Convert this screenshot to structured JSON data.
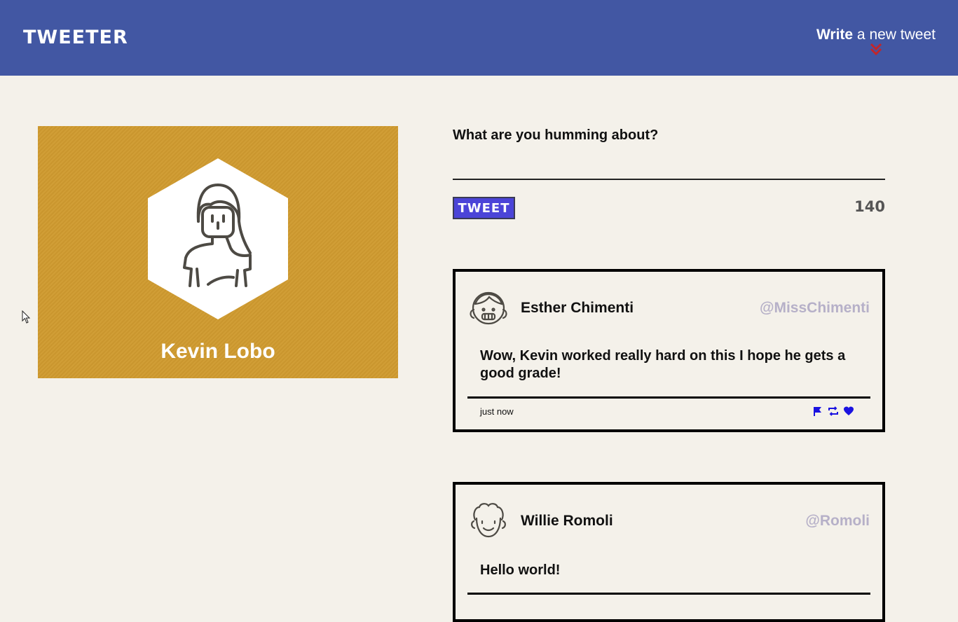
{
  "nav": {
    "brand": "TWEETER",
    "compose_bold": "Write",
    "compose_rest": " a new tweet"
  },
  "profile": {
    "name": "Kevin Lobo",
    "avatar_icon": "girl-avatar-icon"
  },
  "compose": {
    "label": "What are you humming about?",
    "placeholder": "",
    "button_label": "TWEET",
    "counter": "140"
  },
  "tweets": [
    {
      "name": "Esther Chimenti",
      "handle": "@MissChimenti",
      "body": "Wow, Kevin worked really hard on this I hope he gets a good grade!",
      "time": "just now"
    },
    {
      "name": "Willie Romoli",
      "handle": "@Romoli",
      "body": "Hello world!",
      "time": ""
    }
  ],
  "colors": {
    "nav_bg": "#4257a3",
    "page_bg": "#f4f1ea",
    "profile_bg": "#d09b2f",
    "button_bg": "#4b44d8",
    "handle": "#b6b0c8",
    "arrow": "#c0262b",
    "action_icons": "#1a12e0"
  }
}
